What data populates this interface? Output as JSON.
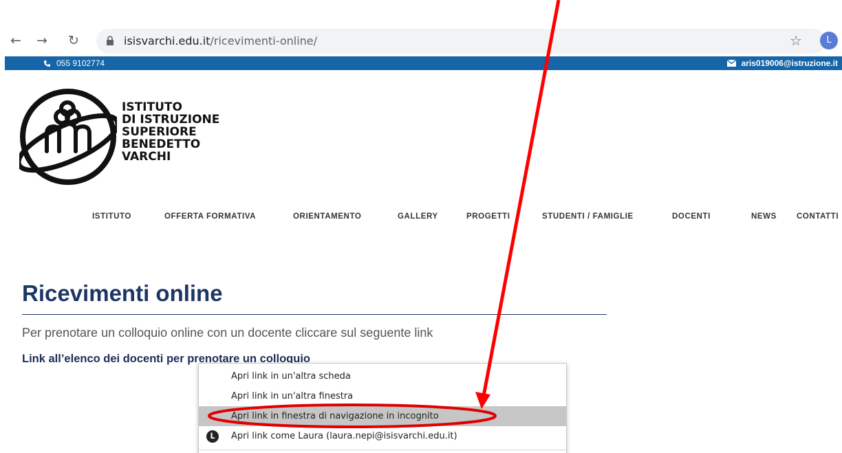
{
  "browser": {
    "back_icon": "arrow-left-icon",
    "forward_icon": "arrow-right-icon",
    "reload_icon": "reload-icon",
    "url_host": "isisvarchi.edu.it",
    "url_path": "/ricevimenti-online/",
    "profile_initial": "L"
  },
  "topbar": {
    "phone": "055 9102774",
    "email": "aris019006@istruzione.it",
    "color": "#1565a8"
  },
  "logo": {
    "lines": [
      "ISTITUTO",
      "DI ISTRUZIONE",
      "SUPERIORE",
      "BENEDETTO",
      "VARCHI"
    ]
  },
  "nav": {
    "items": [
      "ISTITUTO",
      "OFFERTA FORMATIVA",
      "ORIENTAMENTO",
      "GALLERY",
      "PROGETTI",
      "STUDENTI / FAMIGLIE",
      "DOCENTI",
      "NEWS",
      "CONTATTI"
    ]
  },
  "page": {
    "title": "Ricevimenti online",
    "intro": "Per prenotare un colloquio online con un docente cliccare sul seguente link",
    "link": "Link all’elenco dei docenti per prenotare un colloquio",
    "title_color": "#1c3664"
  },
  "context_menu": {
    "items": [
      "Apri link in un'altra scheda",
      "Apri link in un'altra finestra",
      "Apri link in finestra di navigazione in incognito",
      "Apri link come Laura (laura.nepi@isisvarchi.edu.it)"
    ],
    "highlighted_index": 2,
    "profile_icon": "profile-avatar-icon"
  },
  "annotation": {
    "arrow_color": "#ff0000",
    "ellipse_color": "#e00000"
  }
}
